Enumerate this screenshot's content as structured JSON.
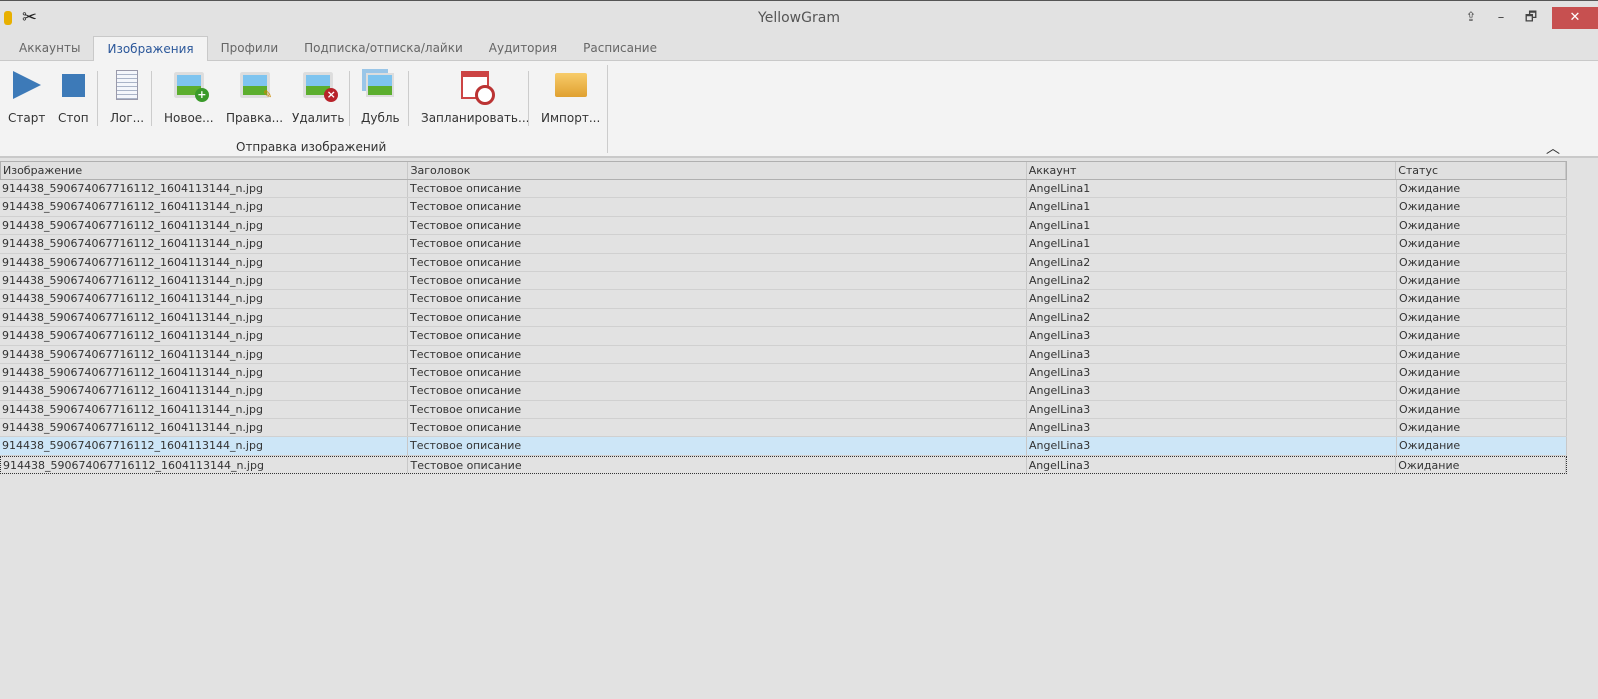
{
  "window": {
    "title": "YellowGram",
    "close": "✕",
    "minimize": "–",
    "restore": "🗗",
    "pin": "⇪"
  },
  "tabs": [
    "Аккаунты",
    "Изображения",
    "Профили",
    "Подписка/отписка/лайки",
    "Аудитория",
    "Расписание"
  ],
  "ribbon": {
    "start": "Старт",
    "stop": "Стоп",
    "log": "Лог...",
    "new": "Новое...",
    "edit": "Правка...",
    "delete": "Удалить",
    "dup": "Дубль",
    "schedule": "Запланировать...",
    "import": "Импорт...",
    "group": "Отправка изображений"
  },
  "table": {
    "columns": [
      "Изображение",
      "Заголовок",
      "Аккаунт",
      "Статус"
    ],
    "rows": [
      [
        "914438_590674067716112_1604113144_n.jpg",
        "Тестовое описание",
        "AngelLina1",
        "Ожидание"
      ],
      [
        "914438_590674067716112_1604113144_n.jpg",
        "Тестовое описание",
        "AngelLina1",
        "Ожидание"
      ],
      [
        "914438_590674067716112_1604113144_n.jpg",
        "Тестовое описание",
        "AngelLina1",
        "Ожидание"
      ],
      [
        "914438_590674067716112_1604113144_n.jpg",
        "Тестовое описание",
        "AngelLina1",
        "Ожидание"
      ],
      [
        "914438_590674067716112_1604113144_n.jpg",
        "Тестовое описание",
        "AngelLina2",
        "Ожидание"
      ],
      [
        "914438_590674067716112_1604113144_n.jpg",
        "Тестовое описание",
        "AngelLina2",
        "Ожидание"
      ],
      [
        "914438_590674067716112_1604113144_n.jpg",
        "Тестовое описание",
        "AngelLina2",
        "Ожидание"
      ],
      [
        "914438_590674067716112_1604113144_n.jpg",
        "Тестовое описание",
        "AngelLina2",
        "Ожидание"
      ],
      [
        "914438_590674067716112_1604113144_n.jpg",
        "Тестовое описание",
        "AngelLina3",
        "Ожидание"
      ],
      [
        "914438_590674067716112_1604113144_n.jpg",
        "Тестовое описание",
        "AngelLina3",
        "Ожидание"
      ],
      [
        "914438_590674067716112_1604113144_n.jpg",
        "Тестовое описание",
        "AngelLina3",
        "Ожидание"
      ],
      [
        "914438_590674067716112_1604113144_n.jpg",
        "Тестовое описание",
        "AngelLina3",
        "Ожидание"
      ],
      [
        "914438_590674067716112_1604113144_n.jpg",
        "Тестовое описание",
        "AngelLina3",
        "Ожидание"
      ],
      [
        "914438_590674067716112_1604113144_n.jpg",
        "Тестовое описание",
        "AngelLina3",
        "Ожидание"
      ],
      [
        "914438_590674067716112_1604113144_n.jpg",
        "Тестовое описание",
        "AngelLina3",
        "Ожидание"
      ],
      [
        "914438_590674067716112_1604113144_n.jpg",
        "Тестовое описание",
        "AngelLina3",
        "Ожидание"
      ]
    ],
    "selected_index": 14,
    "focused_index": 15
  }
}
